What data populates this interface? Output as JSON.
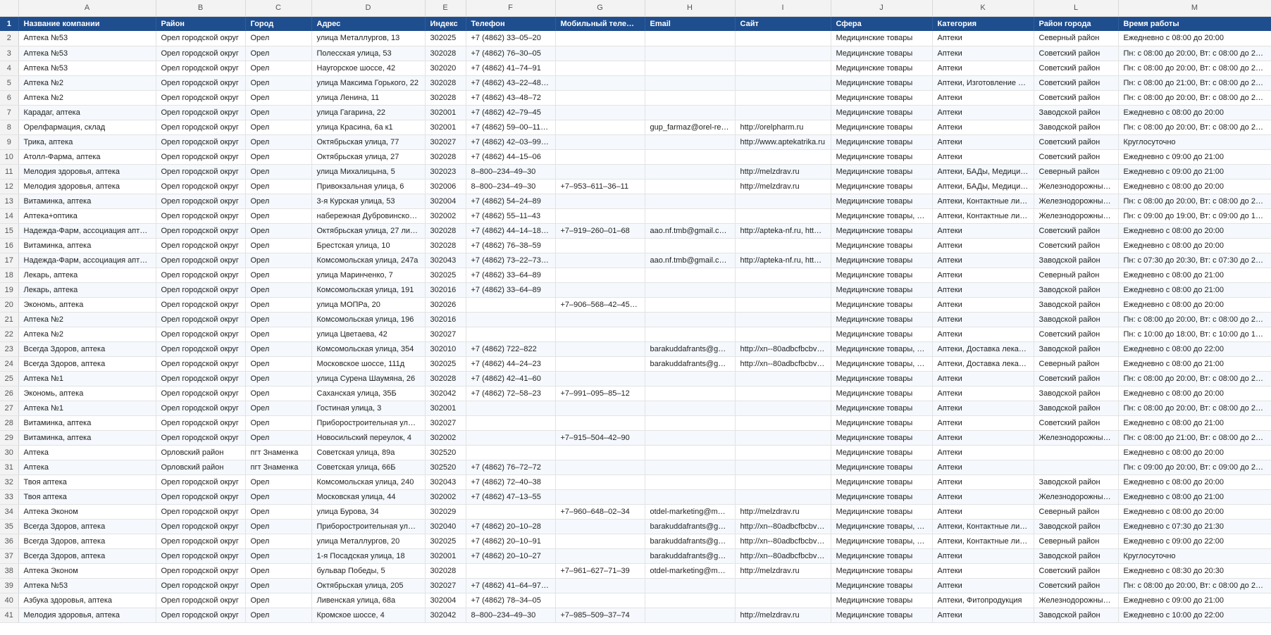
{
  "columns": [
    "A",
    "B",
    "C",
    "D",
    "E",
    "F",
    "G",
    "H",
    "I",
    "J",
    "K",
    "L",
    "M"
  ],
  "header_row_number": "1",
  "headers": [
    "Название компании",
    "Район",
    "Город",
    "Адрес",
    "Индекс",
    "Телефон",
    "Мобильный телефон",
    "Email",
    "Сайт",
    "Сфера",
    "Категория",
    "Район города",
    "Время работы"
  ],
  "rows": [
    {
      "n": "2",
      "c": [
        "Аптека №53",
        "Орел городской округ",
        "Орел",
        "улица Металлургов, 13",
        "302025",
        "+7 (4862) 33‒05‒20",
        "",
        "",
        "",
        "Медицинские товары",
        "Аптеки",
        "Северный район",
        "Ежедневно с 08:00 до 20:00"
      ]
    },
    {
      "n": "3",
      "c": [
        "Аптека №53",
        "Орел городской округ",
        "Орел",
        "Полесская улица, 53",
        "302028",
        "+7 (4862) 76‒30‒05",
        "",
        "",
        "",
        "Медицинские товары",
        "Аптеки",
        "Советский район",
        "Пн: с 08:00 до 20:00, Вт: с 08:00 до 20:00, С..."
      ]
    },
    {
      "n": "4",
      "c": [
        "Аптека №53",
        "Орел городской округ",
        "Орел",
        "Наугорское шоссе, 42",
        "302020",
        "+7 (4862) 41‒74‒91",
        "",
        "",
        "",
        "Медицинские товары",
        "Аптеки",
        "Советский район",
        "Пн: с 08:00 до 20:00, Вт: с 08:00 до 20:00, С..."
      ]
    },
    {
      "n": "5",
      "c": [
        "Аптека №2",
        "Орел городской округ",
        "Орел",
        "улица Максима Горького, 22",
        "302028",
        "+7 (4862) 43‒22‒48, +7...",
        "",
        "",
        "",
        "Медицинские товары",
        "Аптеки, Изготовление лек...",
        "Советский район",
        "Пн: с 08:00 до 21:00, Вт: с 08:00 до 21:00, С..."
      ]
    },
    {
      "n": "6",
      "c": [
        "Аптека №2",
        "Орел городской округ",
        "Орел",
        "улица Ленина, 11",
        "302028",
        "+7 (4862) 43‒48‒72",
        "",
        "",
        "",
        "Медицинские товары",
        "Аптеки",
        "Советский район",
        "Пн: с 08:00 до 20:00, Вт: с 08:00 до 20:00, С..."
      ]
    },
    {
      "n": "7",
      "c": [
        "Карадаг, аптека",
        "Орел городской округ",
        "Орел",
        "улица Гагарина, 22",
        "302001",
        "+7 (4862) 42‒79‒45",
        "",
        "",
        "",
        "Медицинские товары",
        "Аптеки",
        "Заводской район",
        "Ежедневно с 08:00 до 20:00"
      ]
    },
    {
      "n": "8",
      "c": [
        "Орелфармация, склад",
        "Орел городской округ",
        "Орел",
        "улица Красина, 6а к1",
        "302001",
        "+7 (4862) 59‒00‒11, +7...",
        "",
        "gup_farmaz@orel-regio...",
        "http://orelpharm.ru",
        "Медицинские товары",
        "Аптеки",
        "Заводской район",
        "Пн: с 08:00 до 20:00, Вт: с 08:00 до 20:00, С..."
      ]
    },
    {
      "n": "9",
      "c": [
        "Трика, аптека",
        "Орел городской округ",
        "Орел",
        "Октябрьская улица, 77",
        "302027",
        "+7 (4862) 42‒03‒99, 8‒...",
        "",
        "",
        "http://www.aptekatrika.ru",
        "Медицинские товары",
        "Аптеки",
        "Советский район",
        "Круглосуточно"
      ]
    },
    {
      "n": "10",
      "c": [
        "Атолл-Фарма, аптека",
        "Орел городской округ",
        "Орел",
        "Октябрьская улица, 27",
        "302028",
        "+7 (4862) 44‒15‒06",
        "",
        "",
        "",
        "Медицинские товары",
        "Аптеки",
        "Советский район",
        "Ежедневно с 09:00 до 21:00"
      ]
    },
    {
      "n": "11",
      "c": [
        "Мелодия здоровья, аптека",
        "Орел городской округ",
        "Орел",
        "улица Михалицына, 5",
        "302023",
        "8‒800‒234‒49‒30",
        "",
        "",
        "http://melzdrav.ru",
        "Медицинские товары",
        "Аптеки, БАДы, Медицинск...",
        "Северный район",
        "Ежедневно с 09:00 до 21:00"
      ]
    },
    {
      "n": "12",
      "c": [
        "Мелодия здоровья, аптека",
        "Орел городской округ",
        "Орел",
        "Привокзальная улица, 6",
        "302006",
        "8‒800‒234‒49‒30",
        "+7‒953‒611‒36‒11",
        "",
        "http://melzdrav.ru",
        "Медицинские товары",
        "Аптеки, БАДы, Медицинск...",
        "Железнодорожный р...",
        "Ежедневно с 08:00 до 20:00"
      ]
    },
    {
      "n": "13",
      "c": [
        "Витаминка, аптека",
        "Орел городской округ",
        "Орел",
        "3-я Курская улица, 53",
        "302004",
        "+7 (4862) 54‒24‒89",
        "",
        "",
        "",
        "Медицинские товары",
        "Аптеки, Контактные линзы...",
        "Железнодорожный р...",
        "Пн: с 08:00 до 20:00, Вт: с 08:00 до 20:00, С..."
      ]
    },
    {
      "n": "14",
      "c": [
        "Аптека+оптика",
        "Орел городской округ",
        "Орел",
        "набережная Дубровинского, 62",
        "302002",
        "+7 (4862) 55‒11‒43",
        "",
        "",
        "",
        "Медицинские товары, Оде...",
        "Аптеки, Контактные линзы...",
        "Железнодорожный р...",
        "Пн: с 09:00 до 19:00, Вт: с 09:00 до 19:00, С..."
      ]
    },
    {
      "n": "15",
      "c": [
        "Надежда-Фарм, ассоциация аптечны...",
        "Орел городской округ",
        "Орел",
        "Октябрьская улица, 27 лит А",
        "302028",
        "+7 (4862) 44‒14‒18, 8‒...",
        "+7‒919‒260‒01‒68",
        "aao.nf.tmb@gmail.com,...",
        "http://apteka-nf.ru, http://...",
        "Медицинские товары",
        "Аптеки",
        "Советский район",
        "Ежедневно с 08:00 до 20:00"
      ]
    },
    {
      "n": "16",
      "c": [
        "Витаминка, аптека",
        "Орел городской округ",
        "Орел",
        "Брестская улица, 10",
        "302028",
        "+7 (4862) 76‒38‒59",
        "",
        "",
        "",
        "Медицинские товары",
        "Аптеки",
        "Советский район",
        "Ежедневно с 08:00 до 20:00"
      ]
    },
    {
      "n": "17",
      "c": [
        "Надежда-Фарм, ассоциация аптечны...",
        "Орел городской округ",
        "Орел",
        "Комсомольская улица, 247а",
        "302043",
        "+7 (4862) 73‒22‒73, 8‒...",
        "",
        "aao.nf.tmb@gmail.com,...",
        "http://apteka-nf.ru, http://...",
        "Медицинские товары",
        "Аптеки",
        "Заводской район",
        "Пн: с 07:30 до 20:30, Вт: с 07:30 до 20:30, С..."
      ]
    },
    {
      "n": "18",
      "c": [
        "Лекарь, аптека",
        "Орел городской округ",
        "Орел",
        "улица Маринченко, 7",
        "302025",
        "+7 (4862) 33‒64‒89",
        "",
        "",
        "",
        "Медицинские товары",
        "Аптеки",
        "Северный район",
        "Ежедневно с 08:00 до 21:00"
      ]
    },
    {
      "n": "19",
      "c": [
        "Лекарь, аптека",
        "Орел городской округ",
        "Орел",
        "Комсомольская улица, 191",
        "302016",
        "+7 (4862) 33‒64‒89",
        "",
        "",
        "",
        "Медицинские товары",
        "Аптеки",
        "Заводской район",
        "Ежедневно с 08:00 до 21:00"
      ]
    },
    {
      "n": "20",
      "c": [
        "Экономь, аптека",
        "Орел городской округ",
        "Орел",
        "улица МОПРа, 20",
        "302026",
        "",
        "+7‒906‒568‒42‒45, +7...",
        "",
        "",
        "Медицинские товары",
        "Аптеки",
        "Заводской район",
        "Ежедневно с 08:00 до 20:00"
      ]
    },
    {
      "n": "21",
      "c": [
        "Аптека №2",
        "Орел городской округ",
        "Орел",
        "Комсомольская улица, 196",
        "302016",
        "",
        "",
        "",
        "",
        "Медицинские товары",
        "Аптеки",
        "Заводской район",
        "Пн: с 08:00 до 20:00, Вт: с 08:00 до 20:00, С..."
      ]
    },
    {
      "n": "22",
      "c": [
        "Аптека №2",
        "Орел городской округ",
        "Орел",
        "улица Цветаева, 42",
        "302027",
        "",
        "",
        "",
        "",
        "Медицинские товары",
        "Аптеки",
        "Советский район",
        "Пн: с 10:00 до 18:00, Вт: с 10:00 до 18:00, С..."
      ]
    },
    {
      "n": "23",
      "c": [
        "Всегда Здоров, аптека",
        "Орел городской округ",
        "Орел",
        "Комсомольская улица, 354",
        "302010",
        "+7 (4862) 722‒822",
        "",
        "barakuddafrants@gmail...",
        "http://xn--80adbcfbcbv8a...",
        "Медицинские товары, Оде...",
        "Аптеки, Доставка лекарств...",
        "Заводской район",
        "Ежедневно с 08:00 до 22:00"
      ]
    },
    {
      "n": "24",
      "c": [
        "Всегда Здоров, аптека",
        "Орел городской округ",
        "Орел",
        "Московское шоссе, 111д",
        "302025",
        "+7 (4862) 44‒24‒23",
        "",
        "barakuddafrants@gmail...",
        "http://xn--80adbcfbcbv8a...",
        "Медицинские товары, Оде...",
        "Аптеки, Доставка лекарств...",
        "Северный район",
        "Ежедневно с 08:00 до 21:00"
      ]
    },
    {
      "n": "25",
      "c": [
        "Аптека №1",
        "Орел городской округ",
        "Орел",
        "улица Сурена Шаумяна, 26",
        "302028",
        "+7 (4862) 42‒41‒60",
        "",
        "",
        "",
        "Медицинские товары",
        "Аптеки",
        "Советский район",
        "Пн: с 08:00 до 20:00, Вт: с 08:00 до 20:00, С..."
      ]
    },
    {
      "n": "26",
      "c": [
        "Экономь, аптека",
        "Орел городской округ",
        "Орел",
        "Саханская улица, 35Б",
        "302042",
        "+7 (4862) 72‒58‒23",
        "+7‒991‒095‒85‒12",
        "",
        "",
        "Медицинские товары",
        "Аптеки",
        "Заводской район",
        "Ежедневно с 08:00 до 20:00"
      ]
    },
    {
      "n": "27",
      "c": [
        "Аптека №1",
        "Орел городской округ",
        "Орел",
        "Гостиная улица, 3",
        "302001",
        "",
        "",
        "",
        "",
        "Медицинские товары",
        "Аптеки",
        "Заводской район",
        "Пн: с 08:00 до 20:00, Вт: с 08:00 до 20:00, С..."
      ]
    },
    {
      "n": "28",
      "c": [
        "Витаминка, аптека",
        "Орел городской округ",
        "Орел",
        "Приборостроительная улица, ...",
        "302027",
        "",
        "",
        "",
        "",
        "Медицинские товары",
        "Аптеки",
        "Советский район",
        "Ежедневно с 08:00 до 21:00"
      ]
    },
    {
      "n": "29",
      "c": [
        "Витаминка, аптека",
        "Орел городской округ",
        "Орел",
        "Новосильский переулок, 4",
        "302002",
        "",
        "+7‒915‒504‒42‒90",
        "",
        "",
        "Медицинские товары",
        "Аптеки",
        "Железнодорожный р...",
        "Пн: с 08:00 до 21:00, Вт: с 08:00 до 21:00, С..."
      ]
    },
    {
      "n": "30",
      "c": [
        "Аптека",
        "Орловский район",
        "пгт Знаменка",
        "Советская улица, 89а",
        "302520",
        "",
        "",
        "",
        "",
        "Медицинские товары",
        "Аптеки",
        "",
        "Ежедневно с 08:00 до 20:00"
      ]
    },
    {
      "n": "31",
      "c": [
        "Аптека",
        "Орловский район",
        "пгт Знаменка",
        "Советская улица, 66Б",
        "302520",
        "+7 (4862) 76‒72‒72",
        "",
        "",
        "",
        "Медицинские товары",
        "Аптеки",
        "",
        "Пн: с 09:00 до 20:00, Вт: с 09:00 до 20:00, С..."
      ]
    },
    {
      "n": "32",
      "c": [
        "Твоя аптека",
        "Орел городской округ",
        "Орел",
        "Комсомольская улица, 240",
        "302043",
        "+7 (4862) 72‒40‒38",
        "",
        "",
        "",
        "Медицинские товары",
        "Аптеки",
        "Заводской район",
        "Ежедневно с 08:00 до 20:00"
      ]
    },
    {
      "n": "33",
      "c": [
        "Твоя аптека",
        "Орел городской округ",
        "Орел",
        "Московская улица, 44",
        "302002",
        "+7 (4862) 47‒13‒55",
        "",
        "",
        "",
        "Медицинские товары",
        "Аптеки",
        "Железнодорожный р...",
        "Ежедневно с 08:00 до 21:00"
      ]
    },
    {
      "n": "34",
      "c": [
        "Аптека Эконом",
        "Орел городской округ",
        "Орел",
        "улица Бурова, 34",
        "302029",
        "",
        "+7‒960‒648‒02‒34",
        "otdel-marketing@melz...",
        "http://melzdrav.ru",
        "Медицинские товары",
        "Аптеки",
        "Северный район",
        "Ежедневно с 08:00 до 20:00"
      ]
    },
    {
      "n": "35",
      "c": [
        "Всегда Здоров, аптека",
        "Орел городской округ",
        "Орел",
        "Приборостроительная улица, ...",
        "302040",
        "+7 (4862) 20‒10‒28",
        "",
        "barakuddafrants@gmail...",
        "http://xn--80adbcfbcbv8a...",
        "Медицинские товары, Оде...",
        "Аптеки, Контактные линзы...",
        "Заводской район",
        "Ежедневно с 07:30 до 21:30"
      ]
    },
    {
      "n": "36",
      "c": [
        "Всегда Здоров, аптека",
        "Орел городской округ",
        "Орел",
        "улица Металлургов, 20",
        "302025",
        "+7 (4862) 20‒10‒91",
        "",
        "barakuddafrants@gmail...",
        "http://xn--80adbcfbcbv8a...",
        "Медицинские товары, Оде...",
        "Аптеки, Контактные линзы...",
        "Северный район",
        "Ежедневно с 09:00 до 22:00"
      ]
    },
    {
      "n": "37",
      "c": [
        "Всегда Здоров, аптека",
        "Орел городской округ",
        "Орел",
        "1-я Посадская улица, 18",
        "302001",
        "+7 (4862) 20‒10‒27",
        "",
        "barakuddafrants@gmail...",
        "http://xn--80adbcfbcbv8a...",
        "Медицинские товары",
        "Аптеки",
        "Заводской район",
        "Круглосуточно"
      ]
    },
    {
      "n": "38",
      "c": [
        "Аптека Эконом",
        "Орел городской округ",
        "Орел",
        "бульвар Победы, 5",
        "302028",
        "",
        "+7‒961‒627‒71‒39",
        "otdel-marketing@melz...",
        "http://melzdrav.ru",
        "Медицинские товары",
        "Аптеки",
        "Советский район",
        "Ежедневно с 08:30 до 20:30"
      ]
    },
    {
      "n": "39",
      "c": [
        "Аптека №53",
        "Орел городской округ",
        "Орел",
        "Октябрьская улица, 205",
        "302027",
        "+7 (4862) 41‒64‒97, +7...",
        "",
        "",
        "",
        "Медицинские товары",
        "Аптеки",
        "Советский район",
        "Пн: с 08:00 до 20:00, Вт: с 08:00 до 20:00, С..."
      ]
    },
    {
      "n": "40",
      "c": [
        "Азбука здоровья, аптека",
        "Орел городской округ",
        "Орел",
        "Ливенская улица, 68а",
        "302004",
        "+7 (4862) 78‒34‒05",
        "",
        "",
        "",
        "Медицинские товары",
        "Аптеки, Фитопродукция",
        "Железнодорожный р...",
        "Ежедневно с 09:00 до 21:00"
      ]
    },
    {
      "n": "41",
      "c": [
        "Мелодия здоровья, аптека",
        "Орел городской округ",
        "Орел",
        "Кромское шоссе, 4",
        "302042",
        "8‒800‒234‒49‒30",
        "+7‒985‒509‒37‒74",
        "",
        "http://melzdrav.ru",
        "Медицинские товары",
        "Аптеки",
        "Заводской район",
        "Ежедневно с 10:00 до 22:00"
      ]
    }
  ]
}
